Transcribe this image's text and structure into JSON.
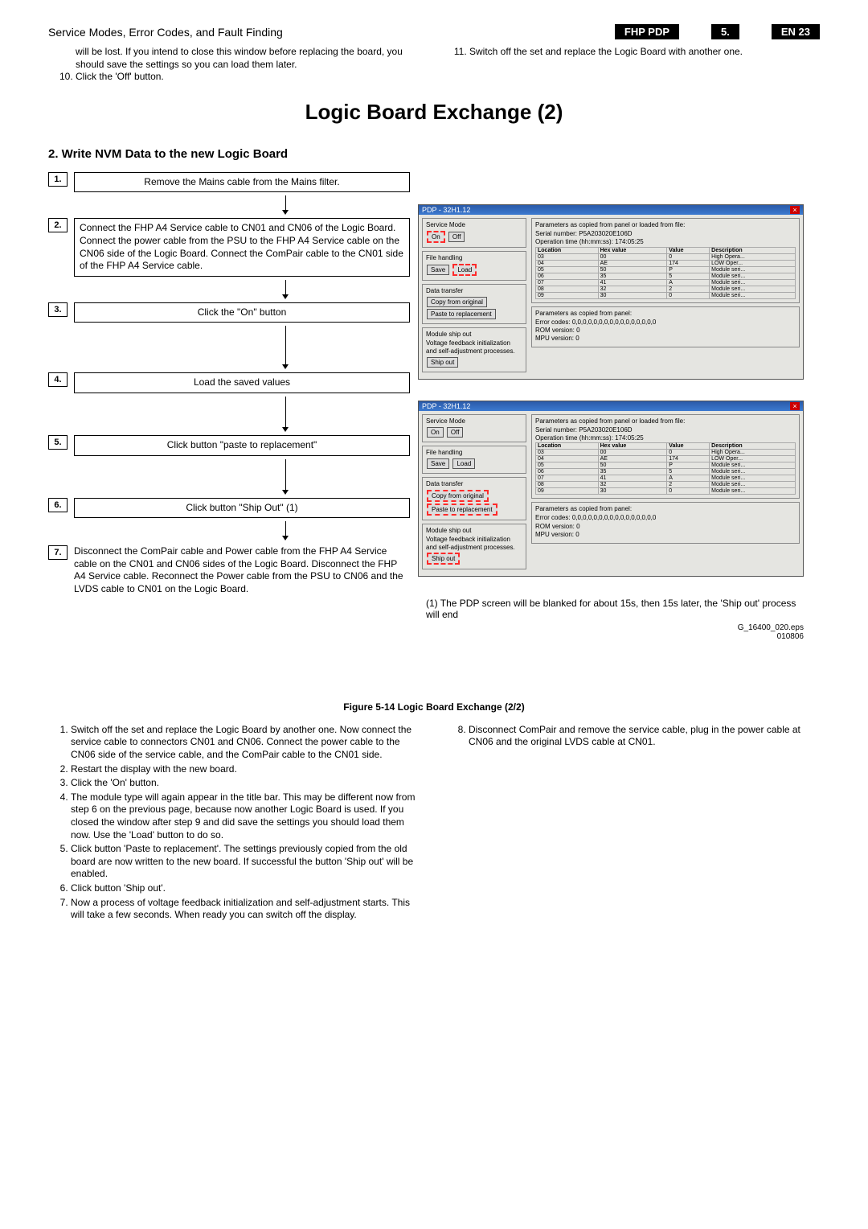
{
  "header": {
    "title": "Service Modes, Error Codes, and Fault Finding",
    "b1": "FHP PDP",
    "b2": "5.",
    "b3": "EN 23"
  },
  "pre": {
    "left_cont": "will be lost. If you intend to close this window before replacing the board, you should save the settings so you can load them later.",
    "left_10": "Click the 'Off' button.",
    "right_11": "Switch off the set and replace the Logic Board with another one."
  },
  "h1": "Logic Board Exchange (2)",
  "h2": "2. Write NVM Data to the new Logic Board",
  "steps": {
    "s1": "Remove the Mains cable from the Mains filter.",
    "s2": "Connect the FHP A4 Service cable to CN01 and CN06 of the Logic Board. Connect the power cable from the PSU to the FHP A4 Service cable on the CN06 side of the Logic Board. Connect the ComPair cable to the CN01 side of the FHP A4 Service cable.",
    "s3": "Click the \"On\" button",
    "s4": "Load the saved values",
    "s5": "Click button \"paste to replacement\"",
    "s6": "Click button \"Ship Out\" (1)",
    "s7": "Disconnect the ComPair cable and Power cable from the FHP A4 Service cable on the CN01 and CN06 sides of the Logic Board. Disconnect the FHP A4 Service cable. Reconnect the Power cable from the PSU to CN06 and the LVDS cable to CN01 on the Logic Board."
  },
  "win": {
    "title": "PDP - 32H1.12",
    "close": "×",
    "grp_service": "Service Mode",
    "btn_on": "On",
    "btn_off": "Off",
    "grp_file": "File handling",
    "btn_save": "Save",
    "btn_load": "Load",
    "grp_data": "Data transfer",
    "btn_copy": "Copy from original",
    "btn_paste": "Paste to replacement",
    "grp_ship": "Module ship out",
    "ship_desc": "Voltage feedback initialization and self-adjustment processes.",
    "btn_ship": "Ship out",
    "params_hdr": "Parameters as copied from panel or loaded from file:",
    "serial_l": "Serial number:",
    "serial_v": "P5A203020E106D",
    "optime_l": "Operation time (hh:mm:ss):",
    "optime_v": "174:05:25",
    "th_loc": "Location",
    "th_hex": "Hex value",
    "th_val": "Value",
    "th_desc": "Description",
    "rows": [
      [
        "03",
        "00",
        "0",
        "High Opera..."
      ],
      [
        "04",
        "AE",
        "174",
        "LOW Oper..."
      ],
      [
        "05",
        "50",
        "P",
        "Module seri..."
      ],
      [
        "06",
        "35",
        "5",
        "Module seri..."
      ],
      [
        "07",
        "41",
        "A",
        "Module seri..."
      ],
      [
        "08",
        "32",
        "2",
        "Module seri..."
      ],
      [
        "09",
        "30",
        "0",
        "Module seri..."
      ]
    ],
    "params2_hdr": "Parameters as copied from panel:",
    "err_l": "Error codes:",
    "err_v": "0,0,0,0,0,0,0,0,0,0,0,0,0,0,0,0",
    "rom_l": "ROM version:",
    "rom_v": "0",
    "mpu_l": "MPU version:",
    "mpu_v": "0"
  },
  "note1": "(1) The PDP screen will be blanked for about 15s, then 15s later, the 'Ship out' process will end",
  "eps1": "G_16400_020.eps",
  "eps2": "010806",
  "fig": "Figure 5-14 Logic Board Exchange (2/2)",
  "post": {
    "l1": "Switch off the set and replace the Logic Board by another one. Now connect the service cable to connectors CN01 and CN06. Connect the power cable to the CN06 side of the service cable, and the ComPair cable to the CN01 side.",
    "l2": "Restart the display with the new board.",
    "l3": "Click the 'On' button.",
    "l4": "The module type will again appear in the title bar. This may be different now from step 6 on the previous page, because now another Logic Board is used. If you closed the window after step 9 and did save the settings you should load them now. Use the 'Load' button to do so.",
    "l5": "Click button 'Paste to replacement'. The settings previously copied from the old board are now written to the new board. If successful the button 'Ship out' will be enabled.",
    "l6": "Click button 'Ship out'.",
    "l7": "Now a process of voltage feedback initialization and self-adjustment starts. This will take a few seconds. When ready you can switch off the display.",
    "r8": "Disconnect ComPair and remove the service cable, plug in the power cable at CN06 and the original LVDS cable at CN01."
  }
}
